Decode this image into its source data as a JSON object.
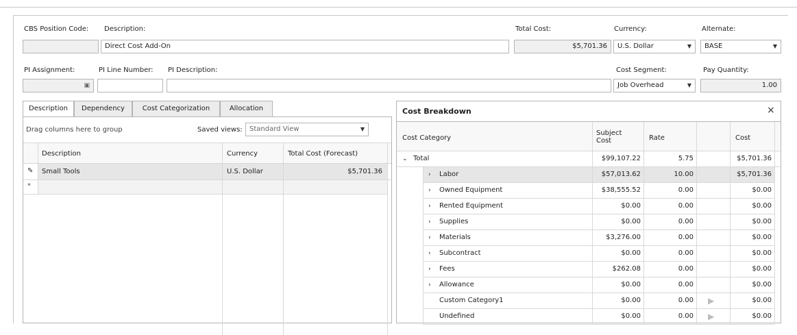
{
  "header": {
    "cbs_label": "CBS Position Code:",
    "cbs_value": "",
    "description_label": "Description:",
    "description_value": "Direct Cost Add-On",
    "total_cost_label": "Total Cost:",
    "total_cost_value": "$5,701.36",
    "currency_label": "Currency:",
    "currency_value": "U.S. Dollar",
    "alternate_label": "Alternate:",
    "alternate_value": "BASE",
    "pi_assignment_label": "PI Assignment:",
    "pi_line_label": "PI Line Number:",
    "pi_description_label": "PI Description:",
    "cost_segment_label": "Cost Segment:",
    "cost_segment_value": "Job Overhead",
    "pay_quantity_label": "Pay Quantity:",
    "pay_quantity_value": "1.00"
  },
  "tabs": [
    {
      "label": "Description"
    },
    {
      "label": "Dependency"
    },
    {
      "label": "Cost Categorization"
    },
    {
      "label": "Allocation"
    }
  ],
  "left_grid": {
    "group_hint": "Drag columns here to group",
    "saved_views_label": "Saved views:",
    "saved_views_value": "Standard View",
    "columns": [
      "Description",
      "Currency",
      "Total Cost (Forecast)"
    ],
    "rows": [
      {
        "description": "Small Tools",
        "currency": "U.S. Dollar",
        "total": "$5,701.36"
      }
    ],
    "new_row_marker": "*"
  },
  "cost_breakdown": {
    "title": "Cost Breakdown",
    "close": "×",
    "columns": [
      "Cost Category",
      "Subject Cost",
      "Rate",
      "",
      "Cost"
    ],
    "rows": [
      {
        "name": "Total",
        "subject": "$99,107.22",
        "rate": "5.75",
        "cost": "$5,701.36",
        "level": 0,
        "expander": "down"
      },
      {
        "name": "Labor",
        "subject": "$57,013.62",
        "rate": "10.00",
        "cost": "$5,701.36",
        "level": 1,
        "expander": "right"
      },
      {
        "name": "Owned Equipment",
        "subject": "$38,555.52",
        "rate": "0.00",
        "cost": "$0.00",
        "level": 1,
        "expander": "right"
      },
      {
        "name": "Rented Equipment",
        "subject": "$0.00",
        "rate": "0.00",
        "cost": "$0.00",
        "level": 1,
        "expander": "right"
      },
      {
        "name": "Supplies",
        "subject": "$0.00",
        "rate": "0.00",
        "cost": "$0.00",
        "level": 1,
        "expander": "right"
      },
      {
        "name": "Materials",
        "subject": "$3,276.00",
        "rate": "0.00",
        "cost": "$0.00",
        "level": 1,
        "expander": "right"
      },
      {
        "name": "Subcontract",
        "subject": "$0.00",
        "rate": "0.00",
        "cost": "$0.00",
        "level": 1,
        "expander": "right"
      },
      {
        "name": "Fees",
        "subject": "$262.08",
        "rate": "0.00",
        "cost": "$0.00",
        "level": 1,
        "expander": "right"
      },
      {
        "name": "Allowance",
        "subject": "$0.00",
        "rate": "0.00",
        "cost": "$0.00",
        "level": 1,
        "expander": "right"
      },
      {
        "name": "Custom Category1",
        "subject": "$0.00",
        "rate": "0.00",
        "cost": "$0.00",
        "level": 1,
        "expander": "none",
        "play": true
      },
      {
        "name": "Undefined",
        "subject": "$0.00",
        "rate": "0.00",
        "cost": "$0.00",
        "level": 1,
        "expander": "none",
        "play": true
      }
    ]
  },
  "colors": {
    "border": "#b4b4b4",
    "selected_row": "#e6e6e6",
    "header_bg": "#f5f5f5"
  }
}
